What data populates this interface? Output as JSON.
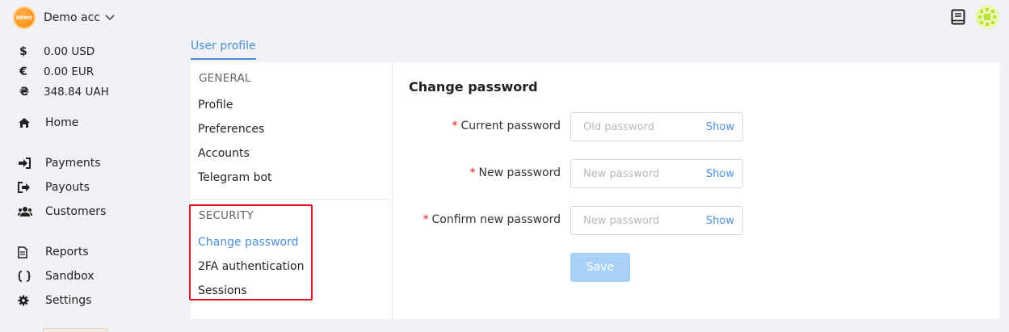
{
  "account": {
    "logo_text": "DEMO",
    "name": "Demo acc"
  },
  "balances": [
    {
      "symbol": "$",
      "value": "0.00 USD"
    },
    {
      "symbol": "€",
      "value": "0.00 EUR"
    },
    {
      "symbol": "₴",
      "value": "348.84 UAH"
    }
  ],
  "nav": {
    "home": "Home",
    "payments": "Payments",
    "payouts": "Payouts",
    "customers": "Customers",
    "reports": "Reports",
    "sandbox": "Sandbox",
    "settings": "Settings"
  },
  "tabs": {
    "user_profile": "User profile"
  },
  "settings_menu": {
    "general_heading": "GENERAL",
    "general_items": [
      "Profile",
      "Preferences",
      "Accounts",
      "Telegram bot"
    ],
    "security_heading": "SECURITY",
    "security_items": [
      "Change password",
      "2FA authentication",
      "Sessions"
    ],
    "active_item": "Change password"
  },
  "form": {
    "title": "Change password",
    "fields": [
      {
        "label": "Current password",
        "placeholder": "Old password",
        "toggle": "Show",
        "required": true
      },
      {
        "label": "New password",
        "placeholder": "New password",
        "toggle": "Show",
        "required": true
      },
      {
        "label": "Confirm new password",
        "placeholder": "New password",
        "toggle": "Show",
        "required": true
      }
    ],
    "required_marker": "*",
    "save_label": "Save"
  },
  "colors": {
    "accent": "#4a90d9",
    "highlight": "#e5101f",
    "save_disabled": "#a9d1f7"
  }
}
